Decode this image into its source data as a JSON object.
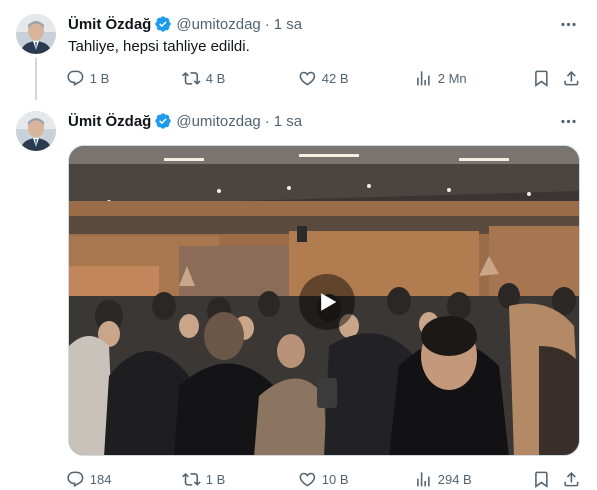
{
  "tweets": [
    {
      "author": {
        "name": "Ümit Özdağ",
        "handle": "@umitozdag",
        "verified": true
      },
      "separator": "·",
      "time": "1 sa",
      "text": "Tahliye, hepsi tahliye edildi.",
      "stats": {
        "replies": "1 B",
        "retweets": "4 B",
        "likes": "42 B",
        "views": "2 Mn"
      }
    },
    {
      "author": {
        "name": "Ümit Özdağ",
        "handle": "@umitozdag",
        "verified": true
      },
      "separator": "·",
      "time": "1 sa",
      "media": {
        "type": "video"
      },
      "stats": {
        "replies": "184",
        "retweets": "1 B",
        "likes": "10 B",
        "views": "294 B"
      }
    }
  ],
  "colors": {
    "verified": "#1d9bf0",
    "muted": "#536471",
    "divider": "#cfd9de",
    "text": "#0f1419"
  },
  "icons": [
    "more-horizontal-icon",
    "reply-icon",
    "retweet-icon",
    "like-icon",
    "views-icon",
    "bookmark-icon",
    "share-icon",
    "verified-badge-icon",
    "play-icon"
  ]
}
